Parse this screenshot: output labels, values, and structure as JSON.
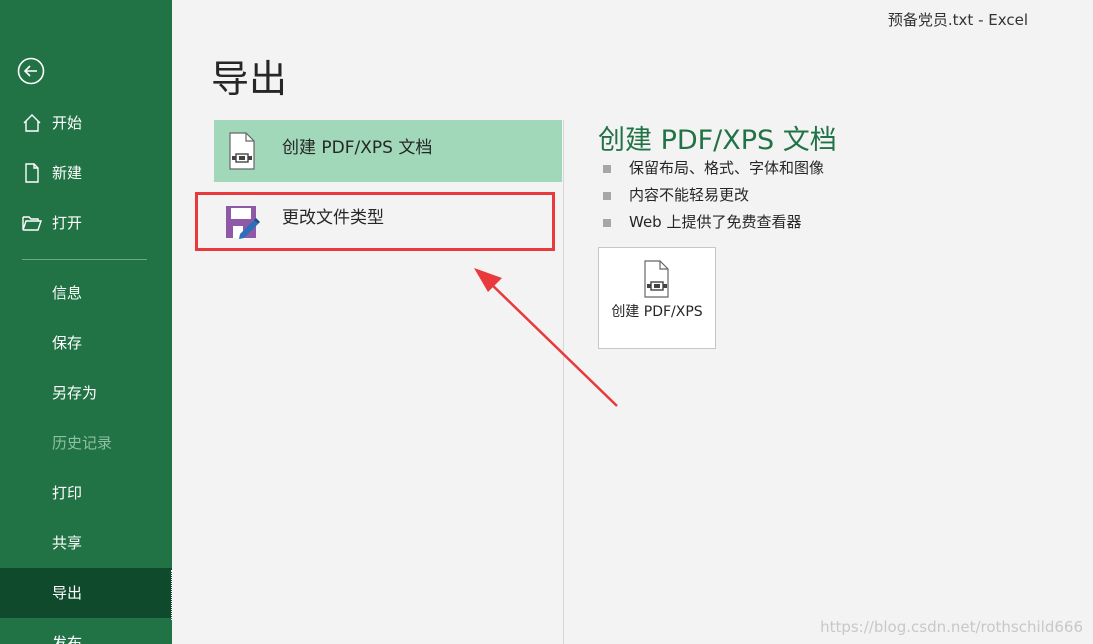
{
  "window": {
    "title": "预备党员.txt  -  Excel"
  },
  "sidebar": {
    "items": [
      {
        "label": "开始",
        "icon": "home-icon"
      },
      {
        "label": "新建",
        "icon": "new-document-icon"
      },
      {
        "label": "打开",
        "icon": "open-folder-icon"
      },
      {
        "label": "信息"
      },
      {
        "label": "保存"
      },
      {
        "label": "另存为"
      },
      {
        "label": "历史记录",
        "disabled": true
      },
      {
        "label": "打印"
      },
      {
        "label": "共享"
      },
      {
        "label": "导出",
        "active": true
      },
      {
        "label": "发布"
      }
    ]
  },
  "main": {
    "title": "导出",
    "options": [
      {
        "label": "创建 PDF/XPS 文档",
        "icon": "pdf-document-icon",
        "selected": true
      },
      {
        "label": "更改文件类型",
        "icon": "change-file-type-icon",
        "selected": false
      }
    ]
  },
  "details": {
    "title": "创建 PDF/XPS 文档",
    "bullets": [
      "保留布局、格式、字体和图像",
      "内容不能轻易更改",
      "Web 上提供了免费查看器"
    ],
    "button_label": "创建 PDF/XPS"
  },
  "watermark": "https://blog.csdn.net/rothschild666",
  "colors": {
    "sidebar": "#217346",
    "active": "#0e4a2b",
    "selected": "#a0d8b9",
    "annotation": "#e8393c"
  }
}
